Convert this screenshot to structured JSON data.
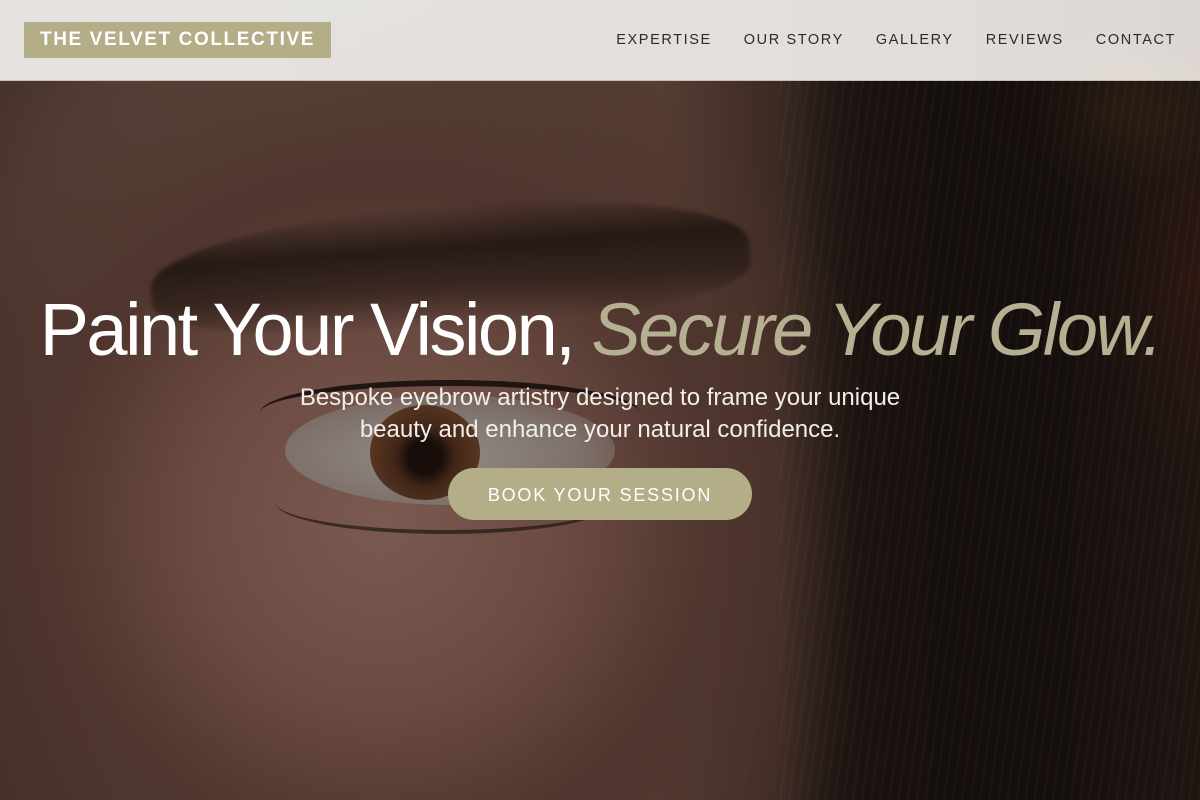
{
  "brand": {
    "name": "THE VELVET COLLECTIVE",
    "accent_color": "#b3ad88"
  },
  "nav": {
    "items": [
      {
        "label": "EXPERTISE"
      },
      {
        "label": "OUR STORY"
      },
      {
        "label": "GALLERY"
      },
      {
        "label": "REVIEWS"
      },
      {
        "label": "CONTACT"
      }
    ]
  },
  "hero": {
    "title_main": "Paint Your Vision, ",
    "title_accent": "Secure Your Glow.",
    "subtitle": "Bespoke eyebrow artistry designed to frame your unique beauty and enhance your natural confidence.",
    "cta_label": "BOOK YOUR SESSION",
    "background": "close-up portrait of an eye and eyebrow",
    "title_color": "#ffffff",
    "title_accent_color": "#b6b092"
  }
}
